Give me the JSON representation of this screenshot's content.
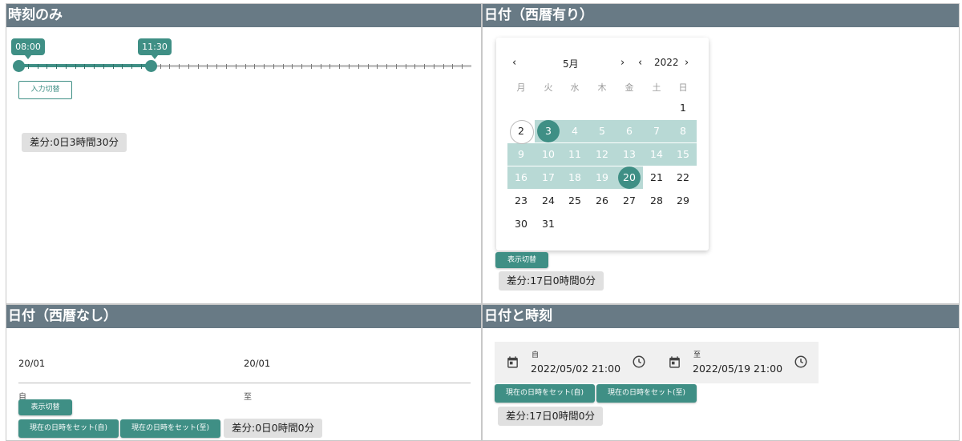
{
  "panels": {
    "time_only": {
      "title": "時刻のみ",
      "slider": {
        "start_label": "08:00",
        "end_label": "11:30",
        "start_fraction": 0.0,
        "end_fraction": 0.2917
      },
      "toggle_label": "入力切替",
      "diff": "差分:0日3時間30分"
    },
    "date_with_year": {
      "title": "日付（西暦有り）",
      "month": "5月",
      "year": "2022",
      "weekdays": [
        "月",
        "火",
        "水",
        "木",
        "金",
        "土",
        "日"
      ],
      "weeks": [
        [
          "",
          "",
          "",
          "",
          "",
          "",
          "1"
        ],
        [
          "2",
          "3",
          "4",
          "5",
          "6",
          "7",
          "8"
        ],
        [
          "9",
          "10",
          "11",
          "12",
          "13",
          "14",
          "15"
        ],
        [
          "16",
          "17",
          "18",
          "19",
          "20",
          "21",
          "22"
        ],
        [
          "23",
          "24",
          "25",
          "26",
          "27",
          "28",
          "29"
        ],
        [
          "30",
          "31",
          "",
          "",
          "",
          "",
          ""
        ]
      ],
      "range_start": "3",
      "range_end": "20",
      "today": "2",
      "toggle_label": "表示切替",
      "diff": "差分:17日0時間0分"
    },
    "date_no_year": {
      "title": "日付（西暦なし）",
      "from_value": "20/01",
      "to_value": "20/01",
      "from_label": "自",
      "to_label": "至",
      "toggle_label": "表示切替",
      "set_now_from_label": "現在の日時をセット(自)",
      "set_now_to_label": "現在の日時をセット(至)",
      "diff": "差分:0日0時間0分"
    },
    "date_and_time": {
      "title": "日付と時刻",
      "from_label": "自",
      "from_value": "2022/05/02 21:00",
      "to_label": "至",
      "to_value": "2022/05/19 21:00",
      "set_now_from_label": "現在の日時をセット(自)",
      "set_now_to_label": "現在の日時をセット(至)",
      "diff": "差分:17日0時間0分"
    }
  },
  "colors": {
    "header": "#687a85",
    "accent": "#3f8f85",
    "range": "#b8d9d5",
    "diff_bg": "#e0e0e0"
  }
}
